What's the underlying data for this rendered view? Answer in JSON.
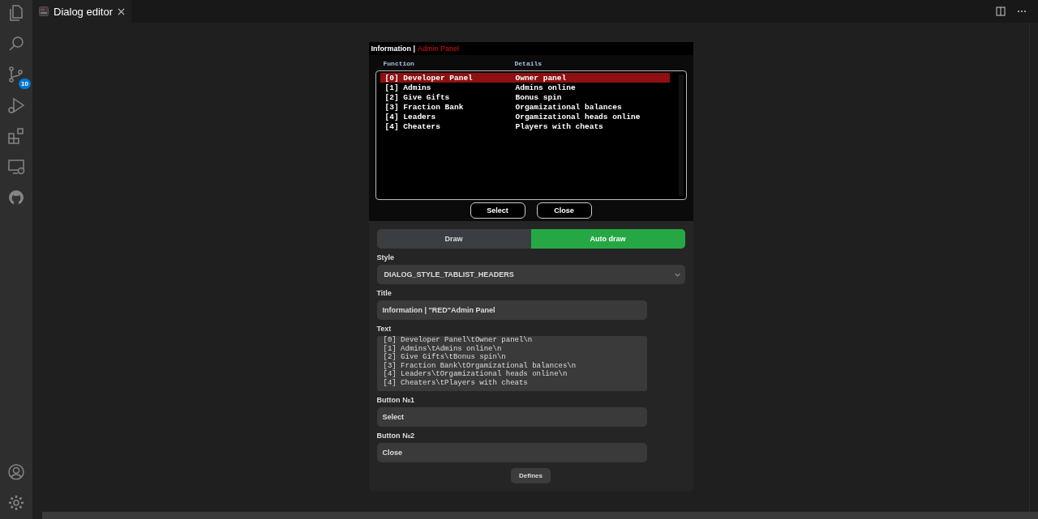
{
  "activity_bar": {
    "scm_badge": "10"
  },
  "tabs": [
    {
      "label": "Dialog editor",
      "selected": true
    }
  ],
  "preview": {
    "title": "Information |",
    "title_accent": "Admin Panel",
    "columns": [
      "Function",
      "Details"
    ],
    "rows": [
      {
        "cells": [
          "[0] Developer Panel",
          "Owner panel"
        ],
        "selected": true
      },
      {
        "cells": [
          "[1] Admins",
          "Admins online"
        ],
        "selected": false
      },
      {
        "cells": [
          "[2] Give Gifts",
          "Bonus spin"
        ],
        "selected": false
      },
      {
        "cells": [
          "[3] Fraction Bank",
          "Orgamizational balances"
        ],
        "selected": false
      },
      {
        "cells": [
          "[4] Leaders",
          "Orgamizational heads online"
        ],
        "selected": false
      },
      {
        "cells": [
          "[4] Cheaters",
          "Players with cheats"
        ],
        "selected": false
      }
    ],
    "buttons": [
      "Select",
      "Close"
    ]
  },
  "form": {
    "modes": [
      {
        "label": "Draw",
        "selected": false
      },
      {
        "label": "Auto draw",
        "selected": true
      }
    ],
    "style_label": "Style",
    "style_value": "DIALOG_STYLE_TABLIST_HEADERS",
    "title_label": "Title",
    "title_value": "Information | \"RED\"Admin Panel",
    "text_label": "Text",
    "text_lines": [
      "[0] Developer Panel\\tOwner panel\\n",
      "[1] Admins\\tAdmins online\\n",
      "[2] Give Gifts\\tBonus spin\\n",
      "[3] Fraction Bank\\tOrgamizational balances\\n",
      "[4] Leaders\\tOrgamizational heads online\\n",
      "[4] Cheaters\\tPlayers with cheats"
    ],
    "button1_label": "Button №1",
    "button1_value": "Select",
    "button2_label": "Button №2",
    "button2_value": "Close",
    "defines_button": "Defines"
  }
}
